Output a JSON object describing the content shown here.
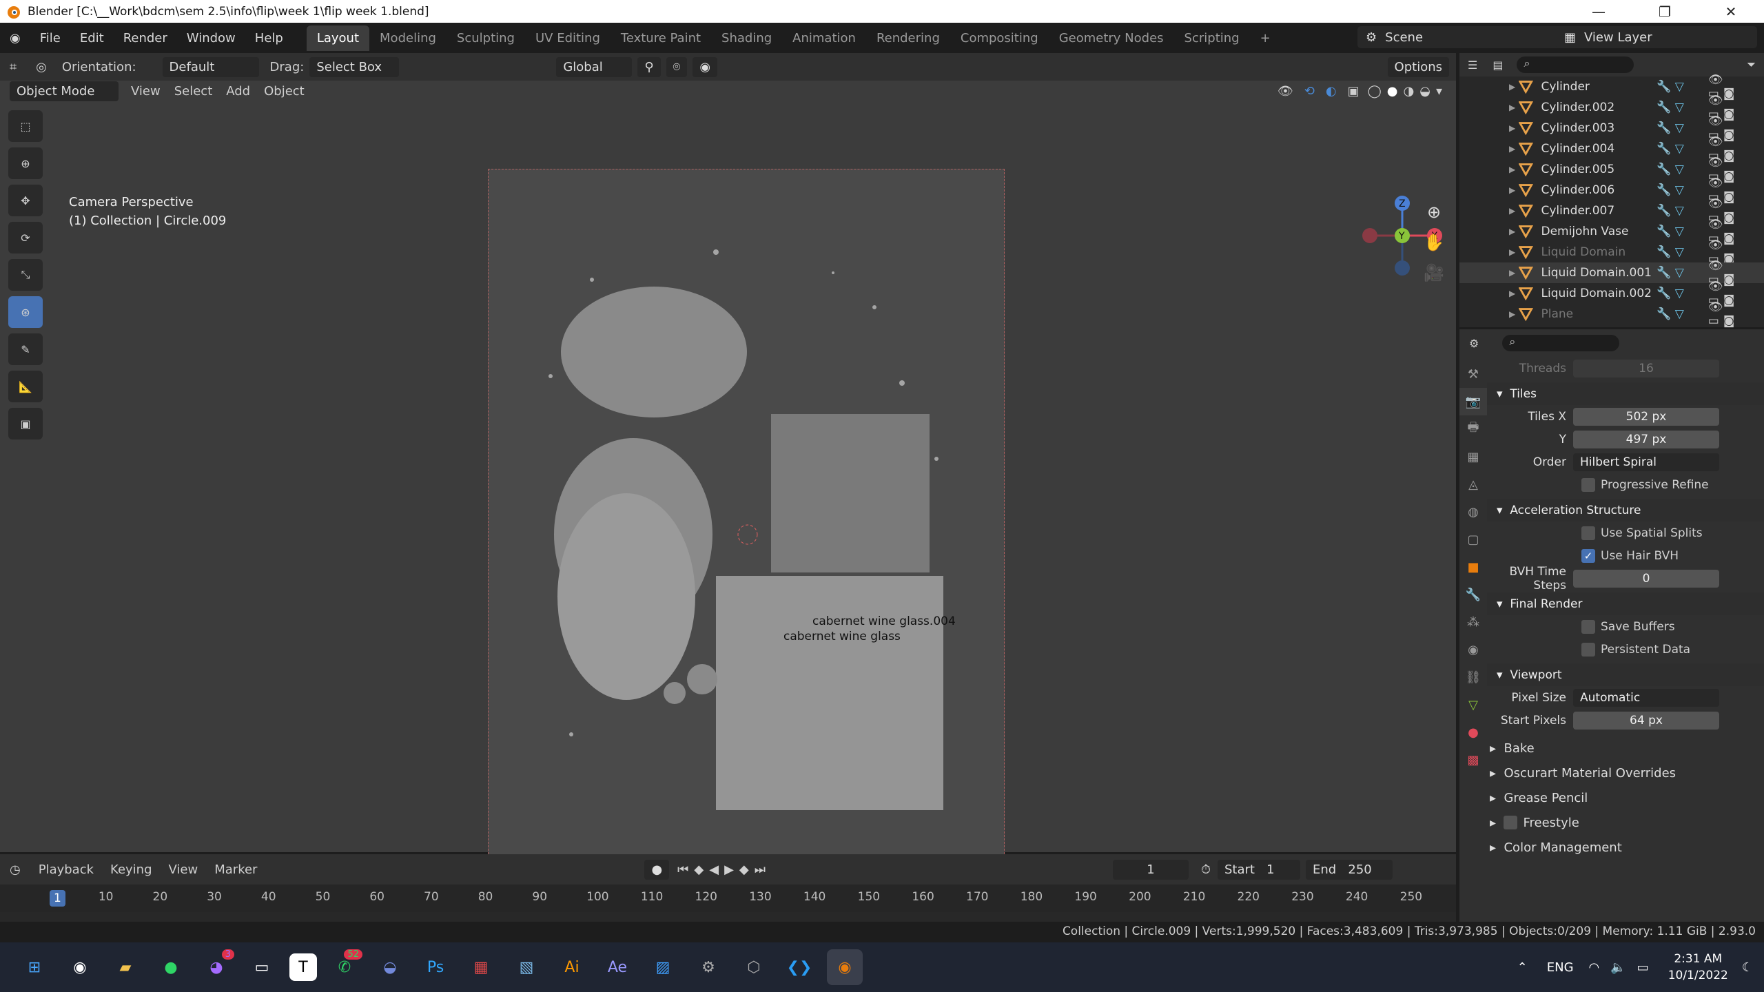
{
  "window": {
    "title": "Blender [C:\\__Work\\bdcm\\sem 2.5\\info\\flip\\week 1\\flip week 1.blend]"
  },
  "menu": [
    "File",
    "Edit",
    "Render",
    "Window",
    "Help"
  ],
  "workspaces": [
    "Layout",
    "Modeling",
    "Sculpting",
    "UV Editing",
    "Texture Paint",
    "Shading",
    "Animation",
    "Rendering",
    "Compositing",
    "Geometry Nodes",
    "Scripting"
  ],
  "scene": "Scene",
  "view_layer": "View Layer",
  "vp": {
    "orientation_label": "Orientation:",
    "orientation": "Default",
    "drag_label": "Drag:",
    "drag": "Select Box",
    "transform": "Global",
    "options": "Options",
    "mode": "Object Mode",
    "menus": [
      "View",
      "Select",
      "Add",
      "Object"
    ],
    "overlay1": "Camera Perspective",
    "overlay2": "(1) Collection | Circle.009",
    "label1": "cabernet wine glass.004",
    "label2": "cabernet wine glass"
  },
  "outliner": [
    {
      "name": "Cylinder",
      "dim": false
    },
    {
      "name": "Cylinder.002",
      "dim": false
    },
    {
      "name": "Cylinder.003",
      "dim": false
    },
    {
      "name": "Cylinder.004",
      "dim": false
    },
    {
      "name": "Cylinder.005",
      "dim": false
    },
    {
      "name": "Cylinder.006",
      "dim": false
    },
    {
      "name": "Cylinder.007",
      "dim": false
    },
    {
      "name": "Demijohn Vase",
      "dim": false
    },
    {
      "name": "Liquid Domain",
      "dim": true
    },
    {
      "name": "Liquid Domain.001",
      "dim": false
    },
    {
      "name": "Liquid Domain.002",
      "dim": false
    },
    {
      "name": "Plane",
      "dim": true
    }
  ],
  "props": {
    "threads_label": "Threads",
    "threads": "16",
    "tiles": "Tiles",
    "tiles_x_label": "Tiles X",
    "tiles_x": "502 px",
    "tiles_y_label": "Y",
    "tiles_y": "497 px",
    "order_label": "Order",
    "order": "Hilbert Spiral",
    "progressive": "Progressive Refine",
    "accel": "Acceleration Structure",
    "spatial": "Use Spatial Splits",
    "hair": "Use Hair BVH",
    "bvh_label": "BVH Time Steps",
    "bvh": "0",
    "final": "Final Render",
    "save_buffers": "Save Buffers",
    "persistent": "Persistent Data",
    "viewport": "Viewport",
    "pixel_label": "Pixel Size",
    "pixel": "Automatic",
    "start_label": "Start Pixels",
    "start": "64 px",
    "closed": [
      "Bake",
      "Oscurart Material Overrides",
      "Grease Pencil",
      "Freestyle",
      "Color Management"
    ]
  },
  "timeline": {
    "menus": [
      "Playback",
      "Keying",
      "View",
      "Marker"
    ],
    "frame": "1",
    "start_label": "Start",
    "start": "1",
    "end_label": "End",
    "end": "250",
    "ticks": [
      "1",
      "10",
      "20",
      "30",
      "40",
      "50",
      "60",
      "70",
      "80",
      "90",
      "100",
      "110",
      "120",
      "130",
      "140",
      "150",
      "160",
      "170",
      "180",
      "190",
      "200",
      "210",
      "220",
      "230",
      "240",
      "250"
    ]
  },
  "status": "Collection | Circle.009 | Verts:1,999,520 | Faces:3,483,609 | Tris:3,973,985 | Objects:0/209 | Memory: 1.11 GiB | 2.93.0",
  "taskbar": {
    "time": "2:31 AM",
    "date": "10/1/2022",
    "lang": "ENG",
    "messenger_badge": "3",
    "whatsapp_badge": "52"
  }
}
